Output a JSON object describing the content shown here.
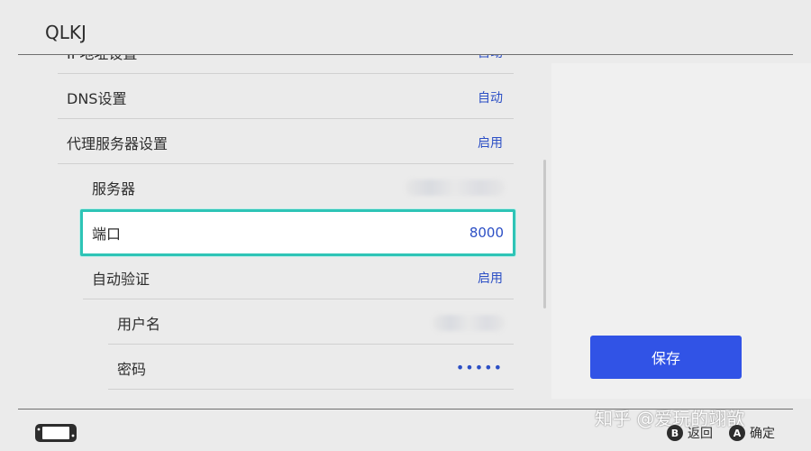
{
  "header": {
    "title": "QLKJ"
  },
  "rows": [
    {
      "label": "IP地址设置",
      "value": "自动"
    },
    {
      "label": "DNS设置",
      "value": "自动"
    },
    {
      "label": "代理服务器设置",
      "value": "启用"
    },
    {
      "label": "服务器",
      "value": ""
    },
    {
      "label": "端口",
      "value": "8000"
    },
    {
      "label": "自动验证",
      "value": "启用"
    },
    {
      "label": "用户名",
      "value": ""
    },
    {
      "label": "密码",
      "value": "•••••"
    }
  ],
  "actions": {
    "save_label": "保存"
  },
  "footer": {
    "back": {
      "button": "B",
      "label": "返回"
    },
    "confirm": {
      "button": "A",
      "label": "确定"
    }
  },
  "watermark": "知乎 @爱玩的翊歆",
  "colors": {
    "accent": "#2c4fc5",
    "selection": "#2ec4b6",
    "button": "#3153e6"
  }
}
